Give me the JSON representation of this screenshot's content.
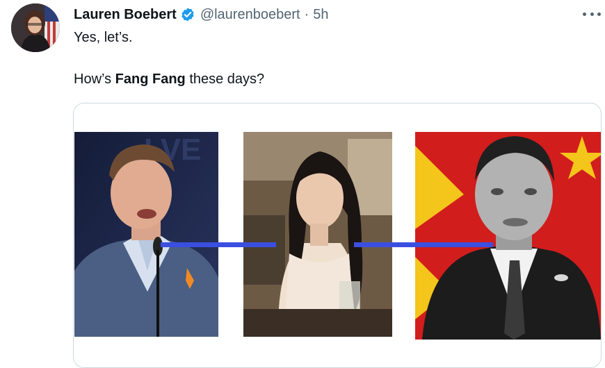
{
  "tweet": {
    "author_name": "Lauren Boebert",
    "handle": "@laurenboebert",
    "separator": "·",
    "time": "5h",
    "line1": "Yes, let’s.",
    "line2_prefix": "How’s ",
    "line2_bold": "Fang Fang",
    "line2_suffix": " these days?"
  },
  "colors": {
    "verified": "#1d9bf0",
    "connector_line": "#3a4fe0",
    "flag_red": "#d21d1d",
    "flag_yellow": "#f4c51a"
  },
  "icons": {
    "verified": "verified-badge-icon",
    "more": "more-options-icon"
  }
}
